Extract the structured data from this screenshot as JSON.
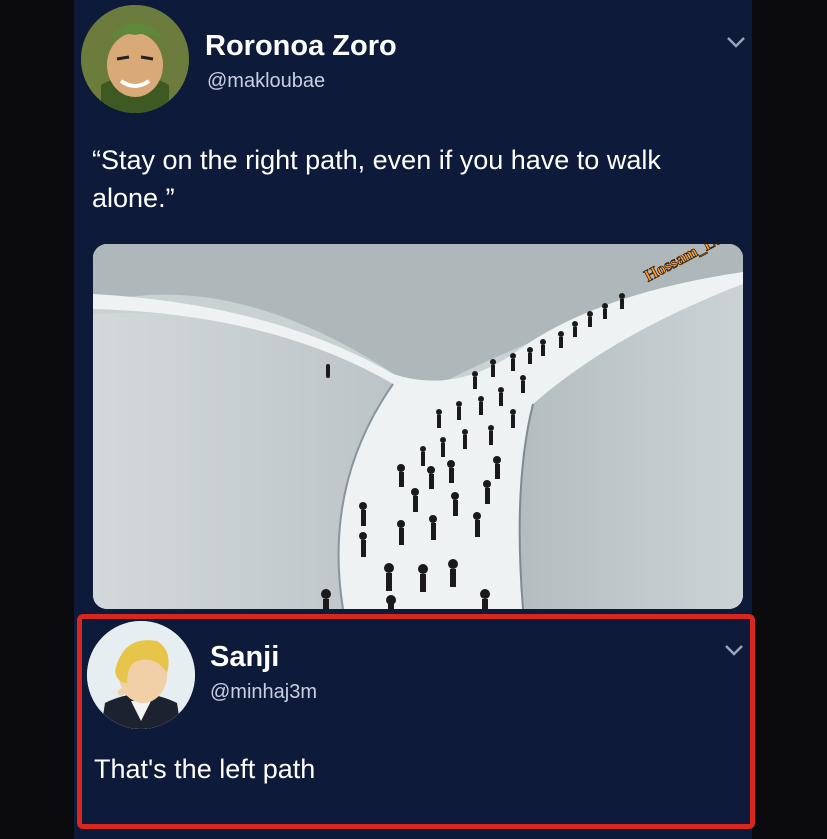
{
  "tweet": {
    "author_name": "Roronoa Zoro",
    "author_handle": "@makloubae",
    "text": "“Stay on the right path, even if you have to walk alone.”",
    "watermark": "Hossam_Luffy",
    "avatar_icon": "zoro-avatar-icon",
    "menu_icon": "chevron-down-icon"
  },
  "reply": {
    "author_name": "Sanji",
    "author_handle": "@minhaj3m",
    "text": "That's the left path",
    "avatar_icon": "sanji-avatar-icon",
    "menu_icon": "chevron-down-icon",
    "highlight_color": "#d7271e"
  },
  "colors": {
    "card_background": "#0d1a3a",
    "page_background": "#0b0b0e"
  }
}
